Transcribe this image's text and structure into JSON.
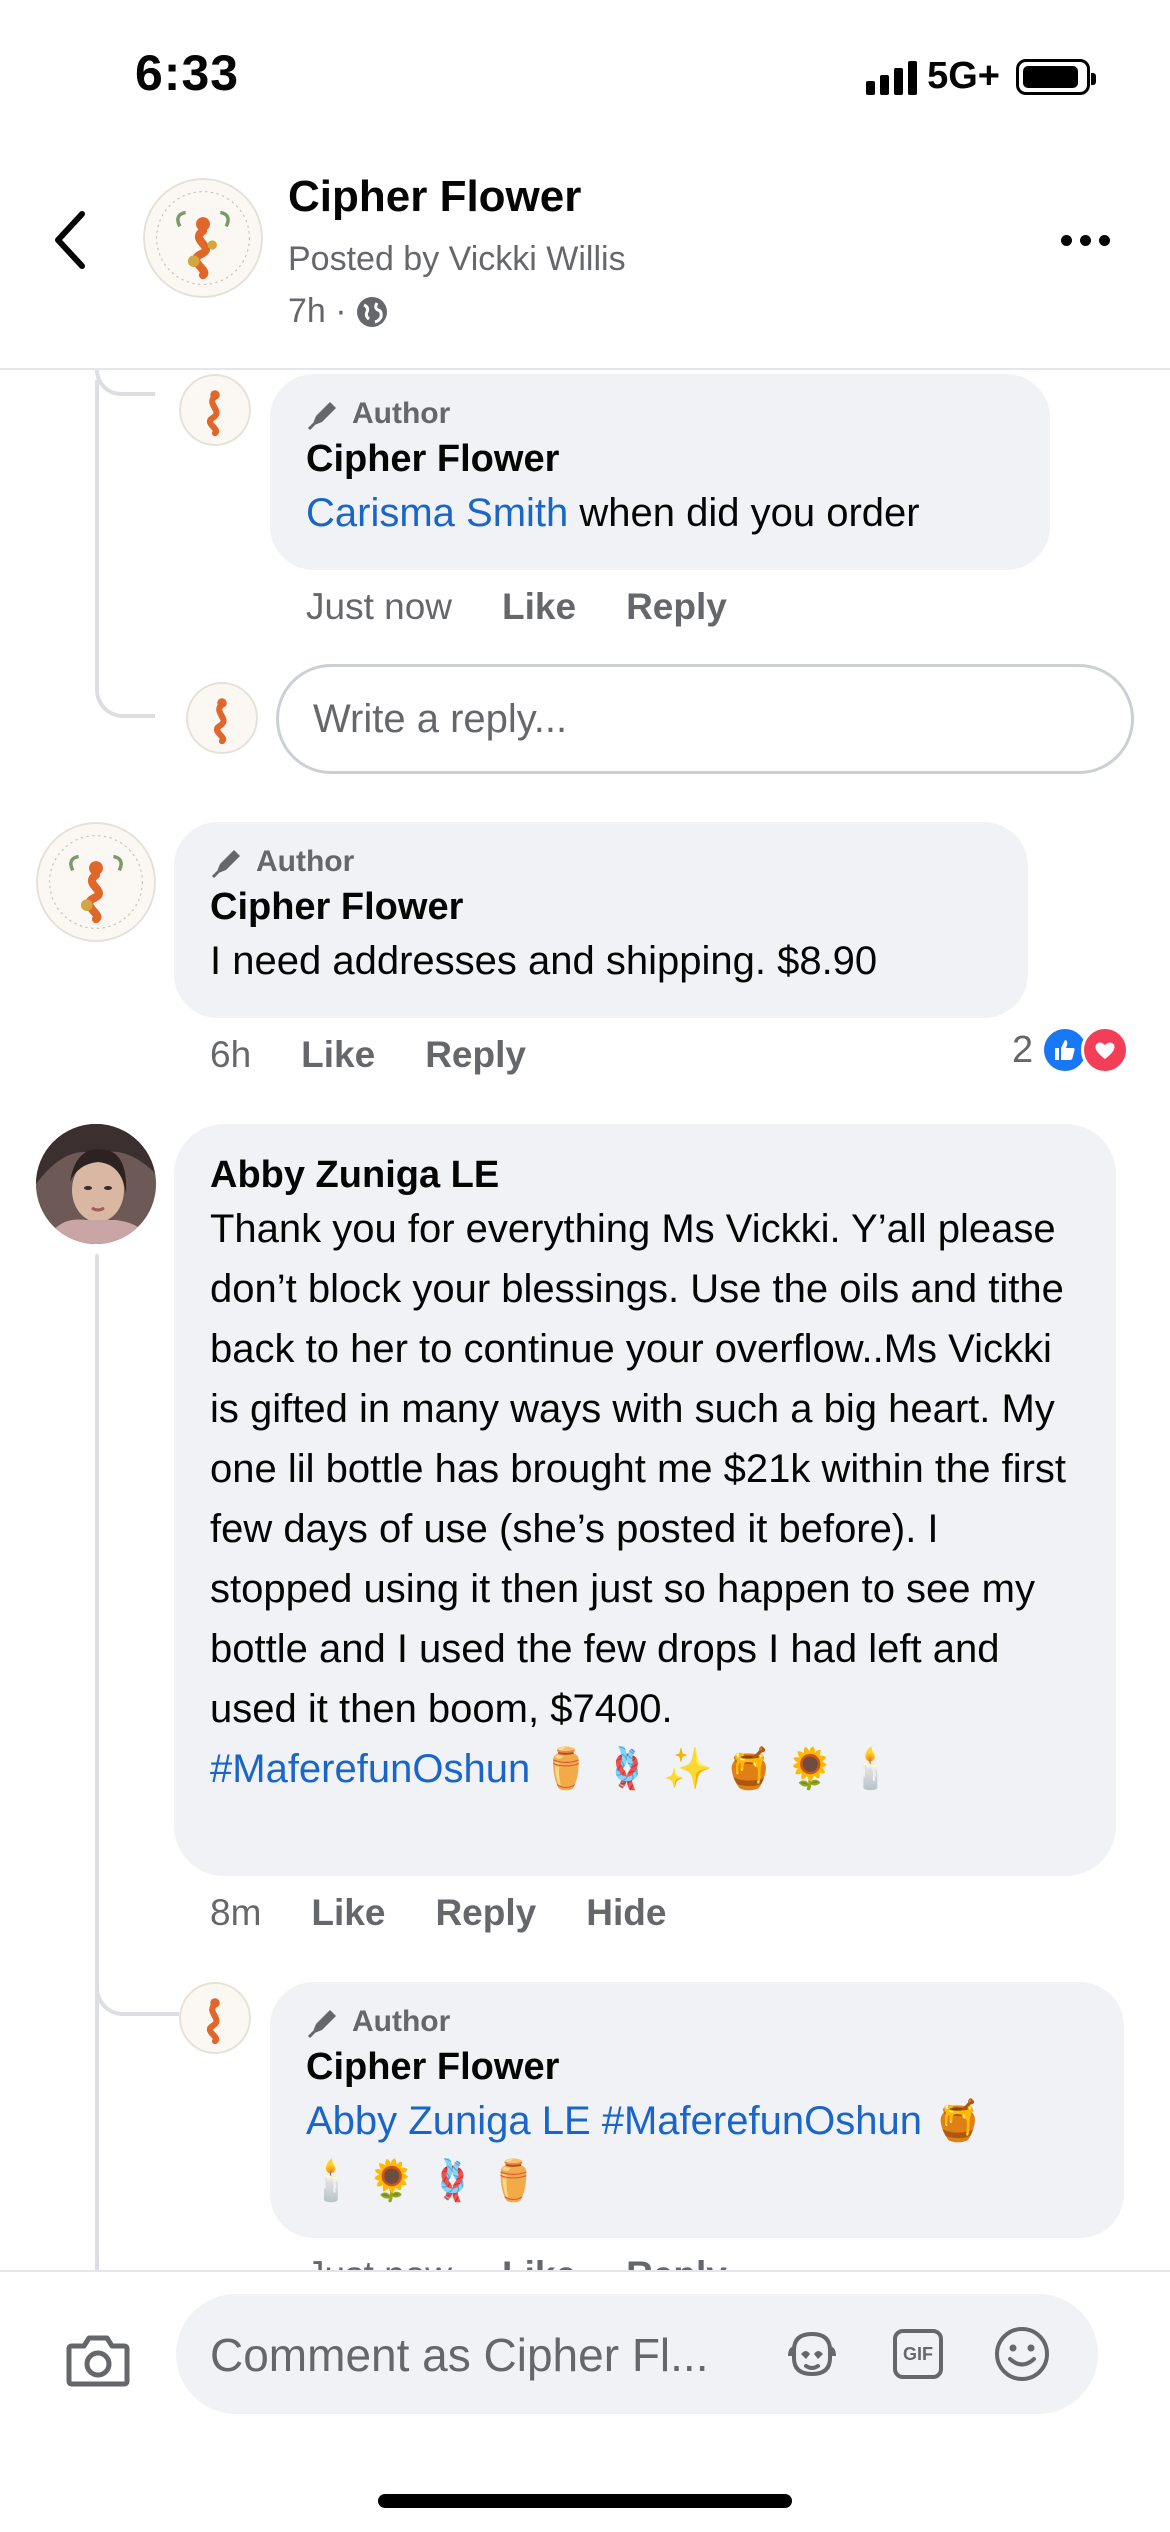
{
  "status_bar": {
    "time": "6:33",
    "network": "5G+"
  },
  "header": {
    "title": "Cipher Flower",
    "posted_by": "Posted by Vickki Willis",
    "time": "7h ·"
  },
  "comments": {
    "reply1": {
      "badge": "Author",
      "name": "Cipher Flower",
      "mention": "Carisma Smith",
      "text": " when did you order",
      "time": "Just now",
      "like": "Like",
      "reply": "Reply"
    },
    "reply_input_placeholder": "Write a reply...",
    "comment1": {
      "badge": "Author",
      "name": "Cipher Flower",
      "text": "I need addresses and  shipping. $8.90",
      "time": "6h",
      "like": "Like",
      "reply": "Reply",
      "reaction_count": "2"
    },
    "comment2": {
      "name": "Abby Zuniga LE",
      "text": "Thank you for everything Ms Vickki. Y’all please don’t block your blessings. Use the oils and tithe back to her to continue your overflow..Ms Vickki is gifted in many ways with such a big heart. My one lil bottle has brought me $21k within the first few days of use (she’s posted it before). I stopped using it then just so happen to see my bottle and I used the few drops I had left and used it then boom, $7400.",
      "hashtag": "#MaferefunOshun",
      "emojis": " ⚱️ 🪢 ✨ 🍯  🌻 🕯️",
      "time": "8m",
      "like": "Like",
      "reply": "Reply",
      "hide": "Hide"
    },
    "reply2": {
      "badge": "Author",
      "name": "Cipher Flower",
      "mention": "Abby Zuniga LE #MaferefunOshun",
      "emojis_line1": " 🍯",
      "emojis_line2": "🕯️ 🌻 🪢 ⚱️",
      "time": "Just now",
      "like": "Like",
      "reply": "Reply"
    }
  },
  "bottom_bar": {
    "placeholder": "Comment as Cipher Fl...",
    "gif_label": "GIF"
  },
  "icons": {
    "back": "chevron-left-icon",
    "more": "more-dots-icon",
    "globe": "globe-icon",
    "author": "pencil-icon",
    "like_reaction": "thumbs-up-icon",
    "love_reaction": "heart-icon",
    "camera": "camera-icon",
    "avatar_sticker": "avatar-sticker-icon",
    "gif": "gif-icon",
    "emoji": "smiley-icon"
  },
  "colors": {
    "link": "#1a65c9",
    "like_blue": "#1877f2",
    "love_red": "#f33e58",
    "bubble": "#f0f2f5"
  }
}
